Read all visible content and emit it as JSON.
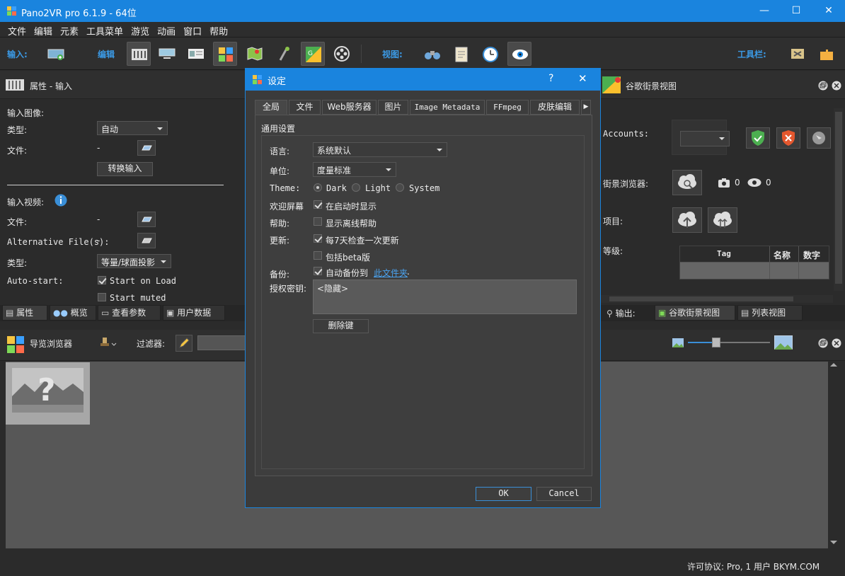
{
  "window": {
    "title": "Pano2VR pro 6.1.9 - 64位",
    "min": "—",
    "max": "☐",
    "close": "✕"
  },
  "menu": [
    "文件",
    "编辑",
    "元素",
    "工具菜单",
    "游览",
    "动画",
    "窗口",
    "帮助"
  ],
  "toolbar": {
    "input_label": "输入:",
    "edit_label": "编辑",
    "view_label": "视图:",
    "tools_label": "工具栏:"
  },
  "props_panel": {
    "title": "属性 - 输入",
    "input_image": "输入图像:",
    "type_label": "类型:",
    "type_value": "自动",
    "file_label": "文件:",
    "file_value": "-",
    "convert_button": "转换输入",
    "input_video": "输入视频:",
    "video_file_label": "文件:",
    "video_file_value": "-",
    "alt_files_label": "Alternative File(s):",
    "alt_files_value": "-",
    "video_type_label": "类型:",
    "video_type_value": "等量/球面投影",
    "autostart_label": "Auto-start:",
    "start_on_load": "Start on Load",
    "start_muted": "Start muted"
  },
  "left_tabs": [
    "属性",
    "概览",
    "查看参数",
    "用户数据"
  ],
  "tour_browser": {
    "title": "导览浏览器",
    "filter_label": "过滤器:"
  },
  "gsv_panel": {
    "title": "谷歌街景视图",
    "accounts_label": "Accounts:",
    "browser_label": "街景浏览器:",
    "photo_count": "0",
    "view_count": "0",
    "project_label": "项目:",
    "level_label": "等级:",
    "table_headers": [
      "Tag",
      "名称",
      "数字"
    ]
  },
  "right_tabs": [
    "输出:",
    "谷歌街景视图",
    "列表视图"
  ],
  "status": {
    "license": "许可协议: Pro, 1 用户 BKYM.COM"
  },
  "dialog": {
    "title": "设定",
    "help": "?",
    "close": "✕",
    "tabs": [
      "全局",
      "文件",
      "Web服务器",
      "图片",
      "Image Metadata",
      "FFmpeg",
      "皮肤编辑"
    ],
    "section": "通用设置",
    "language_label": "语言:",
    "language_value": "系统默认",
    "unit_label": "单位:",
    "unit_value": "度量标准",
    "theme_label": "Theme:",
    "theme_options": [
      "Dark",
      "Light",
      "System"
    ],
    "welcome_label": "欢迎屏幕",
    "welcome_option": "在启动时显示",
    "help_label": "帮助:",
    "help_option": "显示离线帮助",
    "update_label": "更新:",
    "update_option": "每7天检查一次更新",
    "beta_option": "包括beta版",
    "backup_label": "备份:",
    "backup_option": "自动备份到",
    "backup_link": "此文件夹",
    "backup_dot": ".",
    "license_label": "授权密钥:",
    "license_value": "<隐藏>",
    "delete_key_button": "删除键",
    "ok_button": "OK",
    "cancel_button": "Cancel"
  },
  "colors": {
    "accent": "#1a84de",
    "link": "#4aa3f0",
    "panel": "#2b2b2b"
  }
}
